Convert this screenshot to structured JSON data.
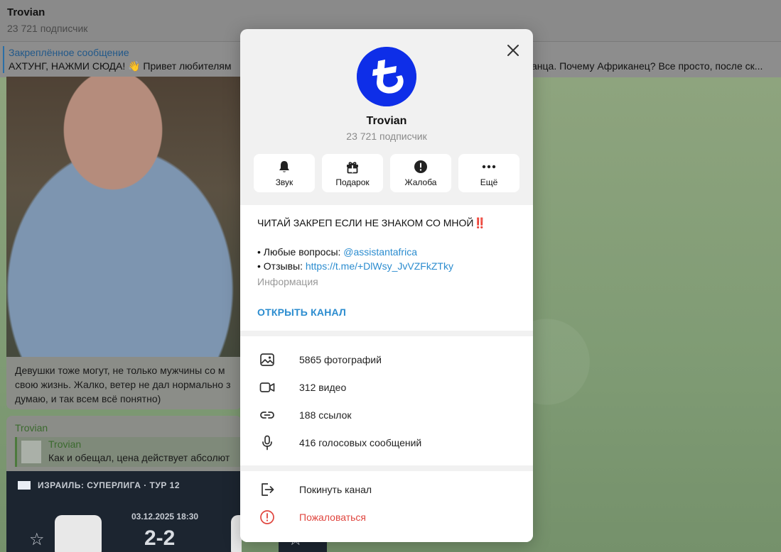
{
  "background": {
    "chat_title": "Trovian",
    "chat_subscribers": "23 721 подписчик",
    "pinned_label": "Закреплённое сообщение",
    "pinned_text_left": "АХТУНГ, НАЖМИ СЮДА! 👋 Привет любителям",
    "pinned_text_right": "анца.  Почему Африканец? Все просто, после ск...",
    "caption_lines": [
      "Девушки тоже могут, не только мужчины со м",
      "свою жизнь. Жалко, ветер не дал нормально з",
      "думаю, и так всем всё понятно)"
    ],
    "msg2_author": "Trovian",
    "reply_author": "Trovian",
    "reply_text": "Как и обещал, цена действует абсолют",
    "match_league": "ИЗРАИЛЬ: СУПЕРЛИГА · ТУР 12",
    "match_date": "03.12.2025 18:30",
    "match_score": "2-2"
  },
  "modal": {
    "channel_name": "Trovian",
    "subscribers": "23 721 подписчик",
    "actions": [
      {
        "label": "Звук",
        "icon": "bell-icon"
      },
      {
        "label": "Подарок",
        "icon": "gift-icon"
      },
      {
        "label": "Жалоба",
        "icon": "alert-icon"
      },
      {
        "label": "Ещё",
        "icon": "more-icon"
      }
    ],
    "info": {
      "line1": "ЧИТАЙ ЗАКРЕП ЕСЛИ НЕ ЗНАКОМ СО МНОЙ‼️",
      "line2_prefix": "• Любые вопросы: ",
      "line2_link": "@assistantafrica",
      "line3_prefix": "• Отзывы: ",
      "line3_link": "https://t.me/+DlWsy_JvVZFkZTky",
      "label": "Информация",
      "open_channel": "ОТКРЫТЬ КАНАЛ"
    },
    "media": [
      {
        "label": "5865 фотографий",
        "icon": "photo-icon"
      },
      {
        "label": "312 видео",
        "icon": "video-icon"
      },
      {
        "label": "188 ссылок",
        "icon": "link-icon"
      },
      {
        "label": "416 голосовых сообщений",
        "icon": "microphone-icon"
      }
    ],
    "leave": {
      "label": "Покинуть канал",
      "icon": "leave-icon"
    },
    "report": {
      "label": "Пожаловаться",
      "icon": "report-icon"
    },
    "colors": {
      "accent": "#2b8ccf",
      "danger": "#e0463f",
      "avatar": "#0e2ee8"
    }
  }
}
